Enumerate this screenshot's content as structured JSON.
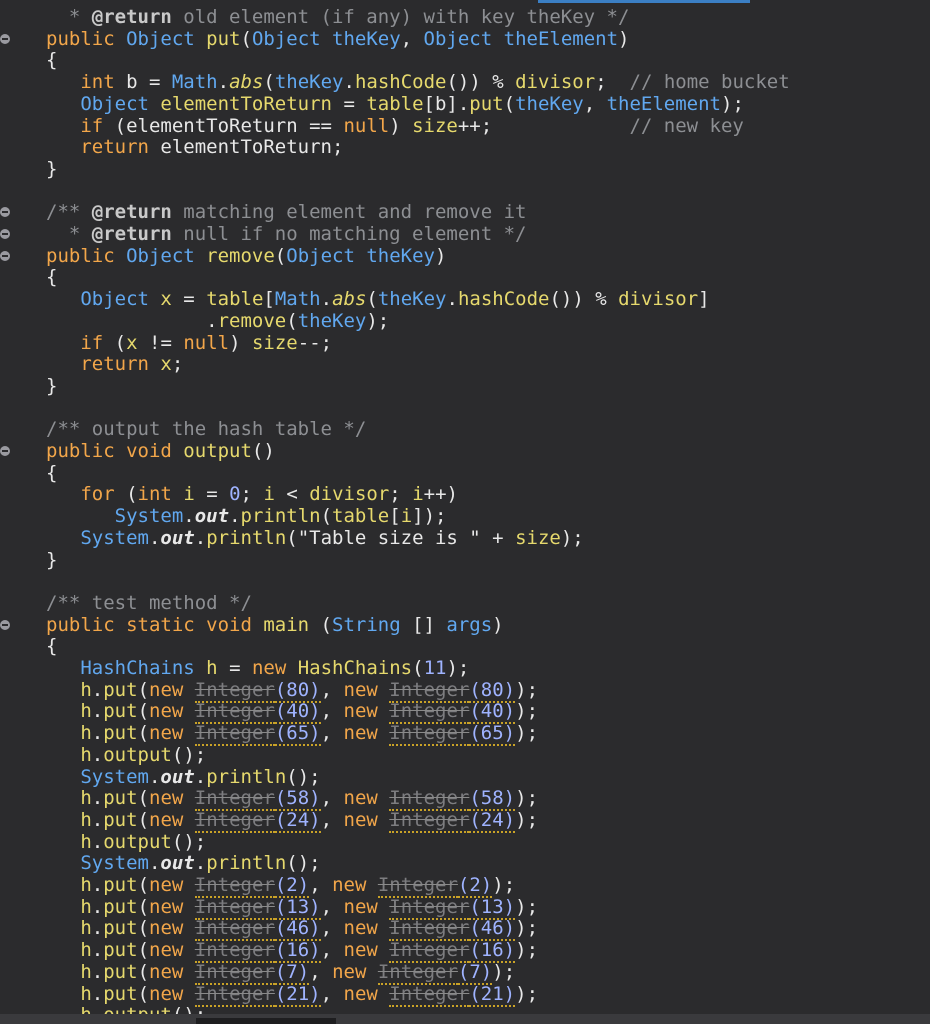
{
  "lines": [
    [
      [
        "c",
        "  * "
      ],
      [
        "a",
        "@return"
      ],
      [
        "c",
        " old element (if any) with key theKey */"
      ]
    ],
    [
      [
        "k",
        "public "
      ],
      [
        "t",
        "Object "
      ],
      [
        "f",
        "put"
      ],
      [
        "p",
        "("
      ],
      [
        "t",
        "Object "
      ],
      [
        "v",
        "theKey"
      ],
      [
        "p",
        ", "
      ],
      [
        "t",
        "Object "
      ],
      [
        "v",
        "theElement"
      ],
      [
        "p",
        ")"
      ]
    ],
    [
      [
        "p",
        "{"
      ]
    ],
    [
      [
        "p",
        "   "
      ],
      [
        "k",
        "int "
      ],
      [
        "p",
        "b = "
      ],
      [
        "t",
        "Math"
      ],
      [
        "p",
        "."
      ],
      [
        "fi",
        "abs"
      ],
      [
        "p",
        "("
      ],
      [
        "v",
        "theKey"
      ],
      [
        "p",
        "."
      ],
      [
        "f",
        "hashCode"
      ],
      [
        "p",
        "()) % "
      ],
      [
        "f",
        "divisor"
      ],
      [
        "p",
        ";  "
      ],
      [
        "c",
        "// home bucket"
      ]
    ],
    [
      [
        "p",
        "   "
      ],
      [
        "t",
        "Object "
      ],
      [
        "f",
        "elementToReturn"
      ],
      [
        "p",
        " = "
      ],
      [
        "f",
        "table"
      ],
      [
        "p",
        "[b]."
      ],
      [
        "f",
        "put"
      ],
      [
        "p",
        "("
      ],
      [
        "v",
        "theKey"
      ],
      [
        "p",
        ", "
      ],
      [
        "v",
        "theElement"
      ],
      [
        "p",
        ");"
      ]
    ],
    [
      [
        "p",
        "   "
      ],
      [
        "k",
        "if "
      ],
      [
        "p",
        "(elementToReturn == "
      ],
      [
        "k",
        "null"
      ],
      [
        "p",
        ") "
      ],
      [
        "f",
        "size"
      ],
      [
        "p",
        "++;"
      ],
      [
        "p",
        "            "
      ],
      [
        "c",
        "// new key"
      ]
    ],
    [
      [
        "p",
        "   "
      ],
      [
        "k",
        "return "
      ],
      [
        "p",
        "elementToReturn;"
      ]
    ],
    [
      [
        "p",
        "}"
      ]
    ],
    [
      [
        "p",
        ""
      ]
    ],
    [
      [
        "c",
        "/** "
      ],
      [
        "a",
        "@return"
      ],
      [
        "c",
        " matching element and remove it"
      ]
    ],
    [
      [
        "c",
        "  * "
      ],
      [
        "a",
        "@return"
      ],
      [
        "c",
        " null if no matching element */"
      ]
    ],
    [
      [
        "k",
        "public "
      ],
      [
        "t",
        "Object "
      ],
      [
        "f",
        "remove"
      ],
      [
        "p",
        "("
      ],
      [
        "t",
        "Object "
      ],
      [
        "v",
        "theKey"
      ],
      [
        "p",
        ")"
      ]
    ],
    [
      [
        "p",
        "{"
      ]
    ],
    [
      [
        "p",
        "   "
      ],
      [
        "t",
        "Object "
      ],
      [
        "f",
        "x"
      ],
      [
        "p",
        " = "
      ],
      [
        "f",
        "table"
      ],
      [
        "p",
        "["
      ],
      [
        "t",
        "Math"
      ],
      [
        "p",
        "."
      ],
      [
        "fi",
        "abs"
      ],
      [
        "p",
        "("
      ],
      [
        "v",
        "theKey"
      ],
      [
        "p",
        "."
      ],
      [
        "f",
        "hashCode"
      ],
      [
        "p",
        "()) % "
      ],
      [
        "f",
        "divisor"
      ],
      [
        "p",
        "]"
      ]
    ],
    [
      [
        "p",
        "              ."
      ],
      [
        "f",
        "remove"
      ],
      [
        "p",
        "("
      ],
      [
        "v",
        "theKey"
      ],
      [
        "p",
        ");"
      ]
    ],
    [
      [
        "p",
        "   "
      ],
      [
        "k",
        "if "
      ],
      [
        "p",
        "("
      ],
      [
        "f",
        "x"
      ],
      [
        "p",
        " != "
      ],
      [
        "k",
        "null"
      ],
      [
        "p",
        ") "
      ],
      [
        "f",
        "size"
      ],
      [
        "p",
        "--;"
      ]
    ],
    [
      [
        "p",
        "   "
      ],
      [
        "k",
        "return "
      ],
      [
        "f",
        "x"
      ],
      [
        "p",
        ";"
      ]
    ],
    [
      [
        "p",
        "}"
      ]
    ],
    [
      [
        "p",
        ""
      ]
    ],
    [
      [
        "c",
        "/** output the hash table */"
      ]
    ],
    [
      [
        "k",
        "public void "
      ],
      [
        "f",
        "output"
      ],
      [
        "p",
        "()"
      ]
    ],
    [
      [
        "p",
        "{"
      ]
    ],
    [
      [
        "p",
        "   "
      ],
      [
        "k",
        "for "
      ],
      [
        "p",
        "("
      ],
      [
        "k",
        "int "
      ],
      [
        "f",
        "i"
      ],
      [
        "p",
        " = "
      ],
      [
        "n",
        "0"
      ],
      [
        "p",
        "; "
      ],
      [
        "f",
        "i"
      ],
      [
        "p",
        " < "
      ],
      [
        "f",
        "divisor"
      ],
      [
        "p",
        "; "
      ],
      [
        "f",
        "i"
      ],
      [
        "p",
        "++)"
      ]
    ],
    [
      [
        "p",
        "      "
      ],
      [
        "t",
        "System"
      ],
      [
        "p",
        "."
      ],
      [
        "o",
        "out"
      ],
      [
        "p",
        "."
      ],
      [
        "f",
        "println"
      ],
      [
        "p",
        "("
      ],
      [
        "f",
        "table"
      ],
      [
        "p",
        "["
      ],
      [
        "f",
        "i"
      ],
      [
        "p",
        "]);"
      ]
    ],
    [
      [
        "p",
        "   "
      ],
      [
        "t",
        "System"
      ],
      [
        "p",
        "."
      ],
      [
        "o",
        "out"
      ],
      [
        "p",
        "."
      ],
      [
        "f",
        "println"
      ],
      [
        "p",
        "(\"Table size is \" + "
      ],
      [
        "f",
        "size"
      ],
      [
        "p",
        ");"
      ]
    ],
    [
      [
        "p",
        "}"
      ]
    ],
    [
      [
        "p",
        ""
      ]
    ],
    [
      [
        "c",
        "/** test method */"
      ]
    ],
    [
      [
        "k",
        "public static void "
      ],
      [
        "f",
        "main "
      ],
      [
        "p",
        "("
      ],
      [
        "t",
        "String "
      ],
      [
        "p",
        "[] "
      ],
      [
        "v",
        "args"
      ],
      [
        "p",
        ")"
      ]
    ],
    [
      [
        "p",
        "{"
      ]
    ],
    [
      [
        "p",
        "   "
      ],
      [
        "t",
        "HashChains "
      ],
      [
        "f",
        "h"
      ],
      [
        "p",
        " = "
      ],
      [
        "k",
        "new "
      ],
      [
        "f",
        "HashChains"
      ],
      [
        "p",
        "("
      ],
      [
        "n",
        "11"
      ],
      [
        "p",
        ");"
      ]
    ],
    [
      [
        "p",
        "   "
      ],
      [
        "f",
        "h"
      ],
      [
        "p",
        "."
      ],
      [
        "f",
        "put"
      ],
      [
        "p",
        "("
      ],
      [
        "k",
        "new "
      ],
      [
        "d",
        "Integer"
      ],
      [
        "dn",
        "(80)"
      ],
      [
        "p",
        ", "
      ],
      [
        "k",
        "new "
      ],
      [
        "d",
        "Integer"
      ],
      [
        "dn",
        "(80)"
      ],
      [
        "p",
        ");"
      ]
    ],
    [
      [
        "p",
        "   "
      ],
      [
        "f",
        "h"
      ],
      [
        "p",
        "."
      ],
      [
        "f",
        "put"
      ],
      [
        "p",
        "("
      ],
      [
        "k",
        "new "
      ],
      [
        "d",
        "Integer"
      ],
      [
        "dn",
        "(40)"
      ],
      [
        "p",
        ", "
      ],
      [
        "k",
        "new "
      ],
      [
        "d",
        "Integer"
      ],
      [
        "dn",
        "(40)"
      ],
      [
        "p",
        ");"
      ]
    ],
    [
      [
        "p",
        "   "
      ],
      [
        "f",
        "h"
      ],
      [
        "p",
        "."
      ],
      [
        "f",
        "put"
      ],
      [
        "p",
        "("
      ],
      [
        "k",
        "new "
      ],
      [
        "d",
        "Integer"
      ],
      [
        "dn",
        "(65)"
      ],
      [
        "p",
        ", "
      ],
      [
        "k",
        "new "
      ],
      [
        "d",
        "Integer"
      ],
      [
        "dn",
        "(65)"
      ],
      [
        "p",
        ");"
      ]
    ],
    [
      [
        "p",
        "   "
      ],
      [
        "f",
        "h"
      ],
      [
        "p",
        "."
      ],
      [
        "f",
        "output"
      ],
      [
        "p",
        "();"
      ]
    ],
    [
      [
        "p",
        "   "
      ],
      [
        "t",
        "System"
      ],
      [
        "p",
        "."
      ],
      [
        "o",
        "out"
      ],
      [
        "p",
        "."
      ],
      [
        "f",
        "println"
      ],
      [
        "p",
        "();"
      ]
    ],
    [
      [
        "p",
        "   "
      ],
      [
        "f",
        "h"
      ],
      [
        "p",
        "."
      ],
      [
        "f",
        "put"
      ],
      [
        "p",
        "("
      ],
      [
        "k",
        "new "
      ],
      [
        "d",
        "Integer"
      ],
      [
        "dn",
        "(58)"
      ],
      [
        "p",
        ", "
      ],
      [
        "k",
        "new "
      ],
      [
        "d",
        "Integer"
      ],
      [
        "dn",
        "(58)"
      ],
      [
        "p",
        ");"
      ]
    ],
    [
      [
        "p",
        "   "
      ],
      [
        "f",
        "h"
      ],
      [
        "p",
        "."
      ],
      [
        "f",
        "put"
      ],
      [
        "p",
        "("
      ],
      [
        "k",
        "new "
      ],
      [
        "d",
        "Integer"
      ],
      [
        "dn",
        "(24)"
      ],
      [
        "p",
        ", "
      ],
      [
        "k",
        "new "
      ],
      [
        "d",
        "Integer"
      ],
      [
        "dn",
        "(24)"
      ],
      [
        "p",
        ");"
      ]
    ],
    [
      [
        "p",
        "   "
      ],
      [
        "f",
        "h"
      ],
      [
        "p",
        "."
      ],
      [
        "f",
        "output"
      ],
      [
        "p",
        "();"
      ]
    ],
    [
      [
        "p",
        "   "
      ],
      [
        "t",
        "System"
      ],
      [
        "p",
        "."
      ],
      [
        "o",
        "out"
      ],
      [
        "p",
        "."
      ],
      [
        "f",
        "println"
      ],
      [
        "p",
        "();"
      ]
    ],
    [
      [
        "p",
        "   "
      ],
      [
        "f",
        "h"
      ],
      [
        "p",
        "."
      ],
      [
        "f",
        "put"
      ],
      [
        "p",
        "("
      ],
      [
        "k",
        "new "
      ],
      [
        "d",
        "Integer"
      ],
      [
        "dn",
        "(2)"
      ],
      [
        "p",
        ", "
      ],
      [
        "k",
        "new "
      ],
      [
        "d",
        "Integer"
      ],
      [
        "dn",
        "(2)"
      ],
      [
        "p",
        ");"
      ]
    ],
    [
      [
        "p",
        "   "
      ],
      [
        "f",
        "h"
      ],
      [
        "p",
        "."
      ],
      [
        "f",
        "put"
      ],
      [
        "p",
        "("
      ],
      [
        "k",
        "new "
      ],
      [
        "d",
        "Integer"
      ],
      [
        "dn",
        "(13)"
      ],
      [
        "p",
        ", "
      ],
      [
        "k",
        "new "
      ],
      [
        "d",
        "Integer"
      ],
      [
        "dn",
        "(13)"
      ],
      [
        "p",
        ");"
      ]
    ],
    [
      [
        "p",
        "   "
      ],
      [
        "f",
        "h"
      ],
      [
        "p",
        "."
      ],
      [
        "f",
        "put"
      ],
      [
        "p",
        "("
      ],
      [
        "k",
        "new "
      ],
      [
        "d",
        "Integer"
      ],
      [
        "dn",
        "(46)"
      ],
      [
        "p",
        ", "
      ],
      [
        "k",
        "new "
      ],
      [
        "d",
        "Integer"
      ],
      [
        "dn",
        "(46)"
      ],
      [
        "p",
        ");"
      ]
    ],
    [
      [
        "p",
        "   "
      ],
      [
        "f",
        "h"
      ],
      [
        "p",
        "."
      ],
      [
        "f",
        "put"
      ],
      [
        "p",
        "("
      ],
      [
        "k",
        "new "
      ],
      [
        "d",
        "Integer"
      ],
      [
        "dn",
        "(16)"
      ],
      [
        "p",
        ", "
      ],
      [
        "k",
        "new "
      ],
      [
        "d",
        "Integer"
      ],
      [
        "dn",
        "(16)"
      ],
      [
        "p",
        ");"
      ]
    ],
    [
      [
        "p",
        "   "
      ],
      [
        "f",
        "h"
      ],
      [
        "p",
        "."
      ],
      [
        "f",
        "put"
      ],
      [
        "p",
        "("
      ],
      [
        "k",
        "new "
      ],
      [
        "d",
        "Integer"
      ],
      [
        "dn",
        "(7)"
      ],
      [
        "p",
        ", "
      ],
      [
        "k",
        "new "
      ],
      [
        "d",
        "Integer"
      ],
      [
        "dn",
        "(7)"
      ],
      [
        "p",
        ");"
      ]
    ],
    [
      [
        "p",
        "   "
      ],
      [
        "f",
        "h"
      ],
      [
        "p",
        "."
      ],
      [
        "f",
        "put"
      ],
      [
        "p",
        "("
      ],
      [
        "k",
        "new "
      ],
      [
        "d",
        "Integer"
      ],
      [
        "dn",
        "(21)"
      ],
      [
        "p",
        ", "
      ],
      [
        "k",
        "new "
      ],
      [
        "d",
        "Integer"
      ],
      [
        "dn",
        "(21)"
      ],
      [
        "p",
        ");"
      ]
    ],
    [
      [
        "p",
        "   "
      ],
      [
        "f",
        "h"
      ],
      [
        "p",
        "."
      ],
      [
        "f",
        "output"
      ],
      [
        "p",
        "();"
      ]
    ]
  ],
  "markers": [
    1,
    9,
    10,
    11,
    20,
    28
  ]
}
